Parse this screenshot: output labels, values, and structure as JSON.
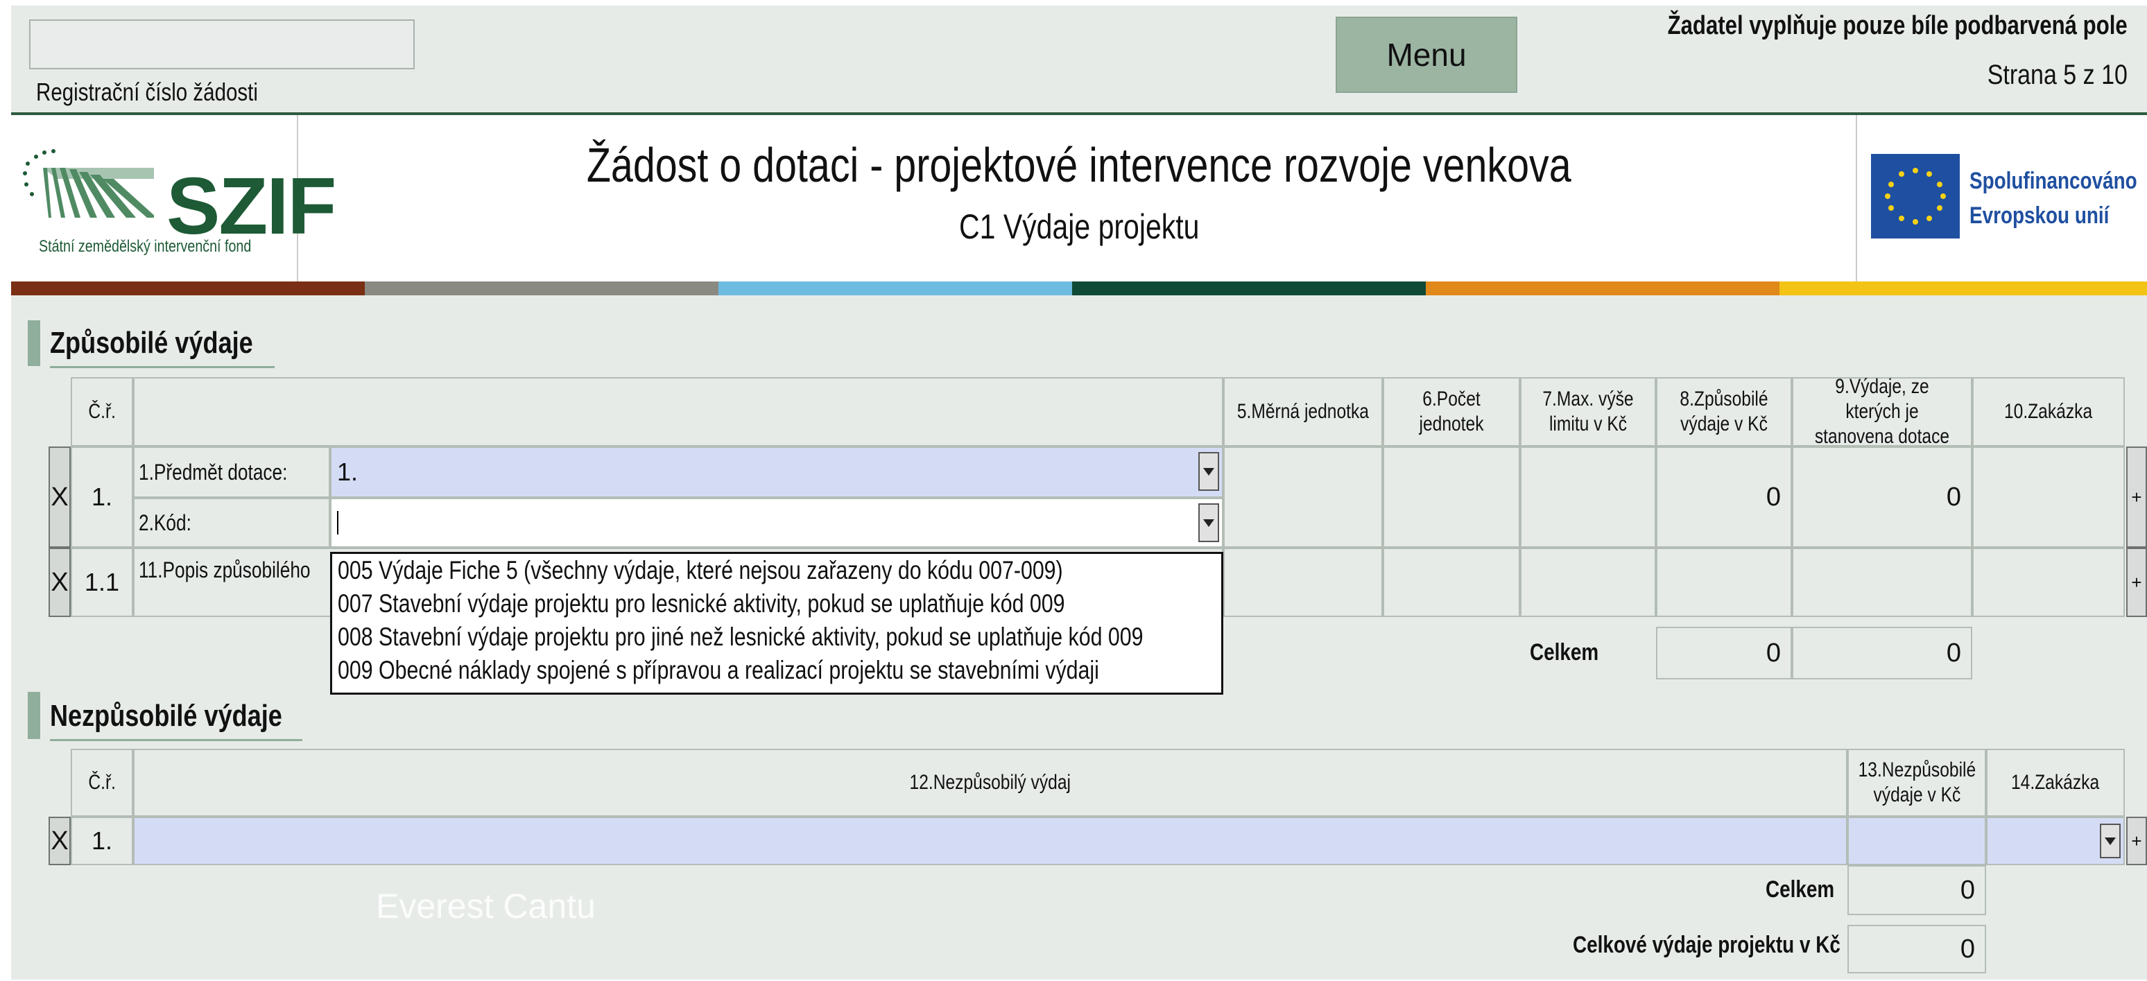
{
  "top": {
    "registration_label": "Registrační číslo žádosti",
    "registration_value": "",
    "menu_label": "Menu",
    "note": "Žadatel vyplňuje pouze bíle podbarvená pole",
    "page_info": "Strana 5 z 10"
  },
  "header": {
    "logo_text": "SZIF",
    "logo_subtitle": "Státní zemědělský intervenční fond",
    "title": "Žádost o dotaci - projektové intervence rozvoje venkova",
    "subtitle": "C1 Výdaje projektu",
    "eu_line1": "Spolufinancováno",
    "eu_line2": "Evropskou unií"
  },
  "colors": {
    "stripes": [
      "#7a2e14",
      "#8a8a82",
      "#6dbbe0",
      "#0e4a35",
      "#e0891a",
      "#f3c316"
    ],
    "field_blue": "#d4dcf5",
    "section_accent": "#8fae9b"
  },
  "eligible": {
    "heading": "Způsobilé výdaje",
    "columns": {
      "cr": "Č.ř.",
      "unit": "5.Měrná jednotka",
      "count": "6.Počet jednotek",
      "max_limit": "7.Max. výše limitu v Kč",
      "eligible_exp": "8.Způsobilé výdaje v Kč",
      "subsidy_base": "9.Výdaje, ze kterých je stanovena dotace",
      "order": "10.Zakázka"
    },
    "row1": {
      "delete": "X",
      "number": "1.",
      "subject_label": "1.Předmět dotace:",
      "subject_value": "1.",
      "code_label": "2.Kód:",
      "code_value": "",
      "eligible_value": "0",
      "subsidy_value": "0",
      "add": "+"
    },
    "row11": {
      "delete": "X",
      "number": "1.1",
      "desc_label": "11.Popis způsobilého",
      "add": "+"
    },
    "total_label": "Celkem",
    "total_eligible": "0",
    "total_subsidy": "0"
  },
  "dropdown": {
    "items": [
      "005 Výdaje Fiche 5 (všechny výdaje, které nejsou zařazeny do kódu 007-009)",
      "007 Stavební výdaje projektu pro lesnické aktivity, pokud se uplatňuje kód 009",
      "008 Stavební výdaje projektu pro jiné než lesnické aktivity, pokud se uplatňuje kód 009",
      "009 Obecné náklady spojené s přípravou a realizací projektu se stavebními výdaji"
    ]
  },
  "ineligible": {
    "heading": "Nezpůsobilé výdaje",
    "columns": {
      "cr": "Č.ř.",
      "expense": "12.Nezpůsobilý výdaj",
      "amount": "13.Nezpůsobilé výdaje v Kč",
      "order": "14.Zakázka"
    },
    "row1": {
      "delete": "X",
      "number": "1.",
      "value": "",
      "amount": "",
      "add": "+"
    },
    "total_label": "Celkem",
    "total_value": "0",
    "grand_total_label": "Celkové výdaje projektu v Kč",
    "grand_total_value": "0"
  },
  "watermark": "Everest Cantu"
}
